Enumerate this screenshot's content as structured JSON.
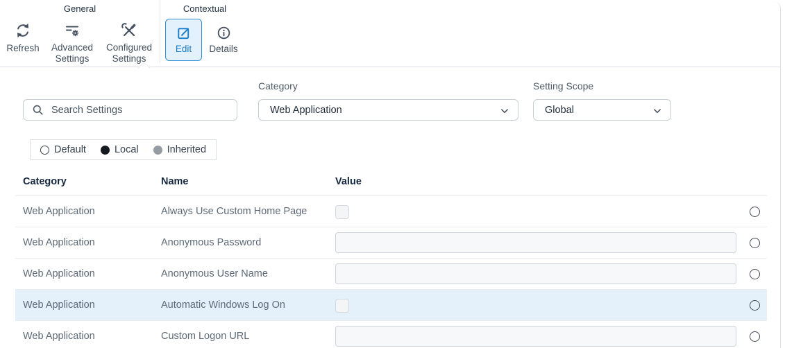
{
  "ribbon": {
    "groups": [
      {
        "label": "General",
        "buttons": [
          {
            "label": "Refresh"
          },
          {
            "label": "Advanced Settings"
          },
          {
            "label": "Configured Settings"
          }
        ]
      },
      {
        "label": "Contextual",
        "buttons": [
          {
            "label": "Edit",
            "active": true
          },
          {
            "label": "Details",
            "active": false
          }
        ]
      }
    ]
  },
  "filters": {
    "search": {
      "placeholder": "Search Settings",
      "value": ""
    },
    "category": {
      "label": "Category",
      "value": "Web Application"
    },
    "scope": {
      "label": "Setting Scope",
      "value": "Global"
    }
  },
  "legend": {
    "items": [
      {
        "label": "Default",
        "marker": "empty"
      },
      {
        "label": "Local",
        "marker": "filled-black"
      },
      {
        "label": "Inherited",
        "marker": "filled-gray"
      }
    ]
  },
  "table": {
    "columns": [
      "Category",
      "Name",
      "Value"
    ],
    "rows": [
      {
        "category": "Web Application",
        "name": "Always Use Custom Home Page",
        "value_type": "checkbox",
        "checked": false,
        "highlighted": false
      },
      {
        "category": "Web Application",
        "name": "Anonymous Password",
        "value_type": "text",
        "value": "",
        "highlighted": false
      },
      {
        "category": "Web Application",
        "name": "Anonymous User Name",
        "value_type": "text",
        "value": "",
        "highlighted": false
      },
      {
        "category": "Web Application",
        "name": "Automatic Windows Log On",
        "value_type": "checkbox",
        "checked": false,
        "highlighted": true
      },
      {
        "category": "Web Application",
        "name": "Custom Logon URL",
        "value_type": "text",
        "value": "",
        "highlighted": false
      }
    ]
  },
  "colors": {
    "accent_blue": "#1a7cc6",
    "accent_blue_bg": "#e3f1fc",
    "accent_blue_border": "#2e8fd5",
    "row_highlight": "#e4f1fb",
    "icon_gray": "#44505f",
    "border_light": "#dcdfe9"
  }
}
